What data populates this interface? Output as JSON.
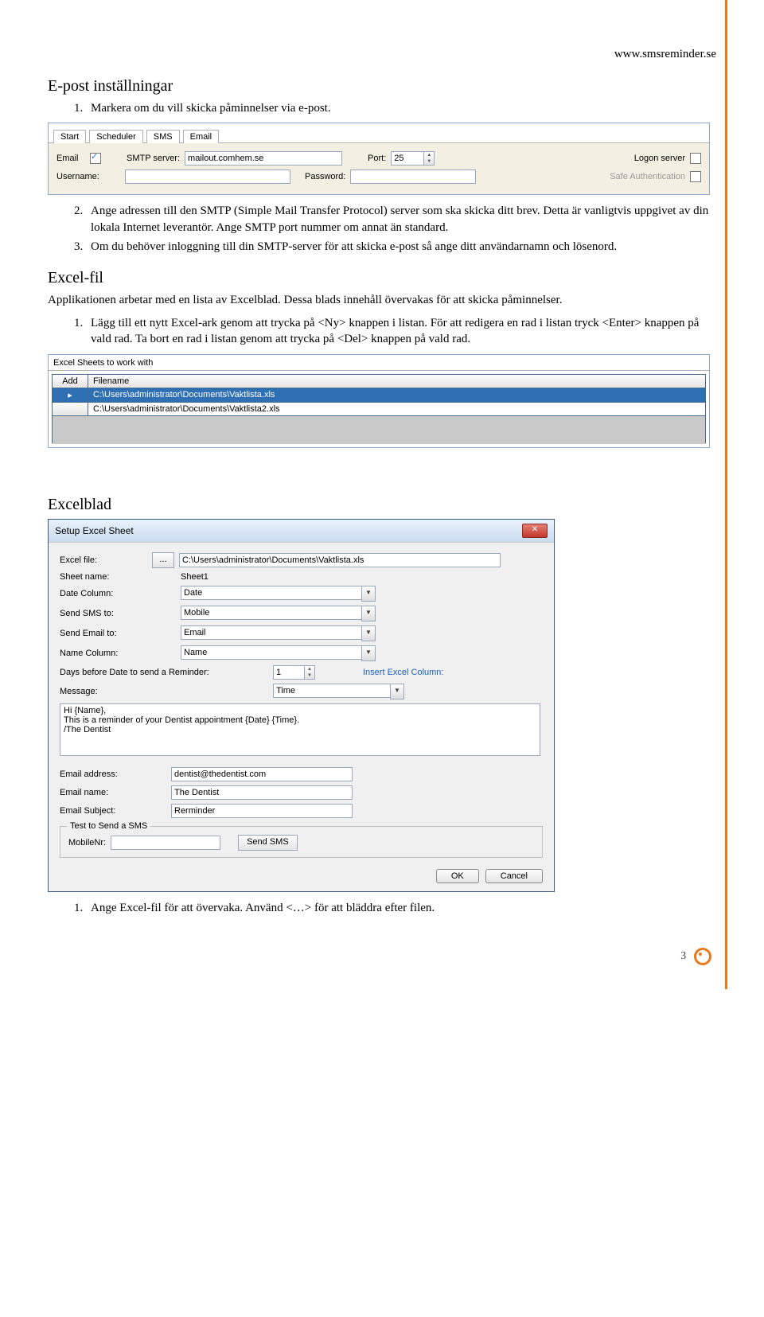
{
  "header": {
    "url": "www.smsreminder.se"
  },
  "section_email": {
    "heading": "E-post inställningar",
    "items": [
      "Markera om du vill skicka påminnelser via e-post.",
      "Ange adressen till den SMTP (Simple Mail Transfer Protocol) server som ska skicka ditt brev. Detta är vanligtvis uppgivet av din lokala Internet leverantör. Ange SMTP port nummer om annat än standard.",
      "Om du behöver inloggning till din SMTP-server för att skicka e-post så ange ditt användarnamn och lösenord."
    ]
  },
  "email_panel": {
    "tabs": [
      "Start",
      "Scheduler",
      "SMS",
      "Email"
    ],
    "active_tab": "Email",
    "labels": {
      "email": "Email",
      "smtp_server": "SMTP server:",
      "port": "Port:",
      "logon": "Logon server",
      "username": "Username:",
      "password": "Password:",
      "safeauth": "Safe Authentication"
    },
    "values": {
      "email_checked": true,
      "smtp_server": "mailout.comhem.se",
      "port": "25",
      "logon_checked": false,
      "username": "",
      "password": "",
      "safeauth_checked": false
    }
  },
  "section_excelfil": {
    "heading": "Excel-fil",
    "intro": "Applikationen arbetar med en lista av Excelblad. Dessa blads innehåll övervakas för att skicka påminnelser.",
    "items": [
      "Lägg till ett nytt Excel-ark genom att trycka på <Ny> knappen i listan. För att redigera en rad i listan tryck <Enter> knappen på vald rad. Ta bort en rad i listan genom att trycka på <Del> knappen på vald rad."
    ]
  },
  "sheets_panel": {
    "title": "Excel Sheets to work with",
    "add_label": "Add",
    "col_label": "Filename",
    "rows": [
      "C:\\Users\\administrator\\Documents\\Vaktlista.xls",
      "C:\\Users\\administrator\\Documents\\Vaktlista2.xls"
    ]
  },
  "section_excelblad": {
    "heading": "Excelblad"
  },
  "dialog": {
    "title": "Setup Excel Sheet",
    "labels": {
      "excel_file": "Excel file:",
      "browse": "...",
      "sheet_name": "Sheet name:",
      "date_col": "Date Column:",
      "send_sms": "Send SMS to:",
      "send_email": "Send Email to:",
      "name_col": "Name Column:",
      "days_before": "Days before Date to send a Reminder:",
      "insert_col": "Insert Excel Column:",
      "message": "Message:",
      "email_addr": "Email address:",
      "email_name": "Email name:",
      "email_subj": "Email Subject:",
      "group": "Test to Send a SMS",
      "mobile": "MobileNr:",
      "send_sms_btn": "Send SMS",
      "ok": "OK",
      "cancel": "Cancel"
    },
    "values": {
      "excel_file": "C:\\Users\\administrator\\Documents\\Vaktlista.xls",
      "sheet_name": "Sheet1",
      "date_col": "Date",
      "send_sms": "Mobile",
      "send_email": "Email",
      "name_col": "Name",
      "days_before": "1",
      "insert_col": "Time",
      "message": "Hi {Name},\nThis is a reminder of your Dentist appointment {Date} {Time}.\n/The Dentist",
      "email_addr": "dentist@thedentist.com",
      "email_name": "The Dentist",
      "email_subj": "Rerminder",
      "mobile": ""
    }
  },
  "section_last": {
    "items": [
      "Ange Excel-fil för att övervaka. Använd <…> för att bläddra efter filen."
    ]
  },
  "footer": {
    "page": "3"
  }
}
